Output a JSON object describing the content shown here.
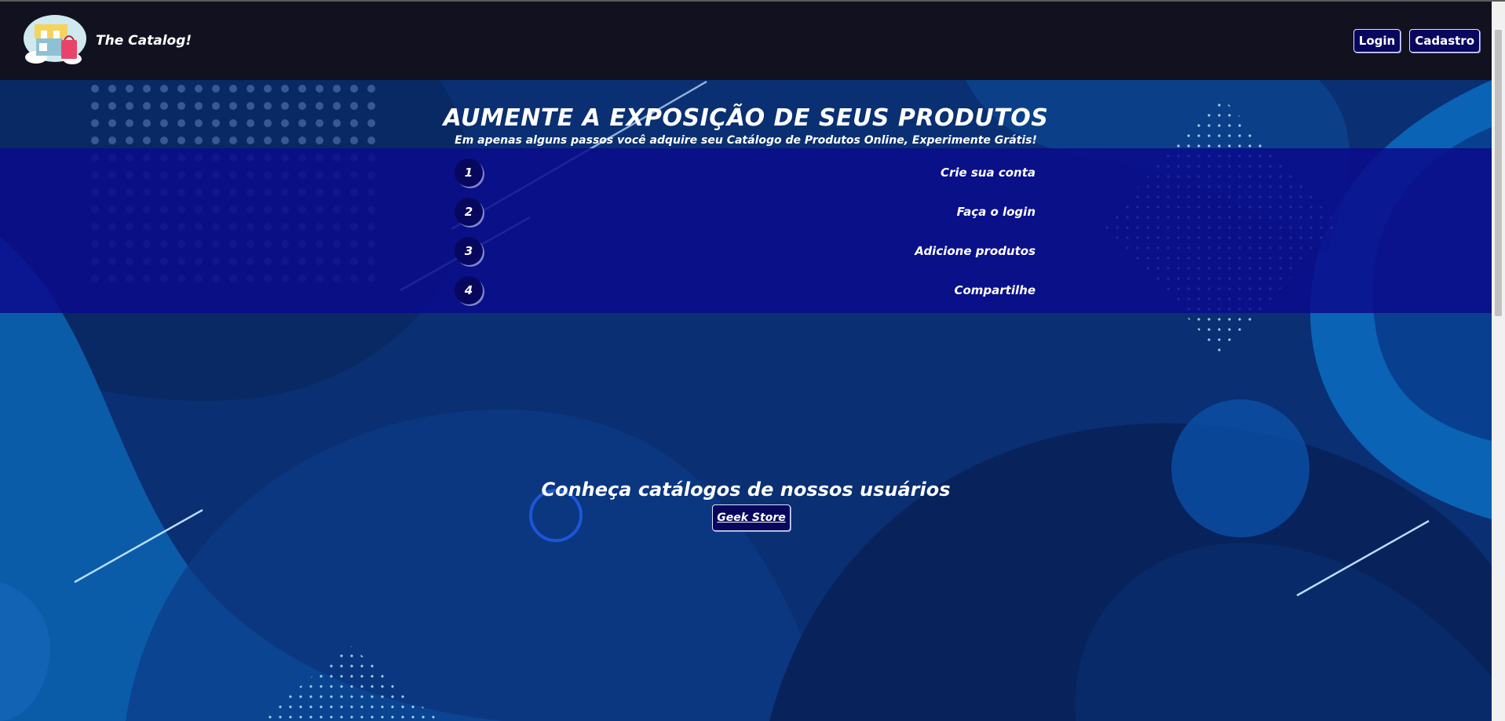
{
  "colors": {
    "navbar": "#12111f",
    "page_background": "#0b2d6b",
    "steps_band": "#0a0a8c",
    "button_fill": "#07075e",
    "accent_line": "#b9dcff"
  },
  "header": {
    "brand_title": "The Catalog!",
    "logo_icon": "storefront-shopping-bag-icon",
    "login_label": "Login",
    "signup_label": "Cadastro"
  },
  "hero": {
    "title": "AUMENTE A EXPOSIÇÃO DE SEUS PRODUTOS",
    "subtitle": "Em apenas alguns passos você adquire seu Catálogo de Produtos Online, Experimente Grátis!",
    "steps": [
      {
        "number": "1",
        "label": "Crie sua conta"
      },
      {
        "number": "2",
        "label": "Faça o login"
      },
      {
        "number": "3",
        "label": "Adicione produtos"
      },
      {
        "number": "4",
        "label": "Compartilhe"
      }
    ]
  },
  "catalogs": {
    "title": "Conheça catálogos de nossos usuários",
    "stores": [
      "Geek Store"
    ]
  }
}
